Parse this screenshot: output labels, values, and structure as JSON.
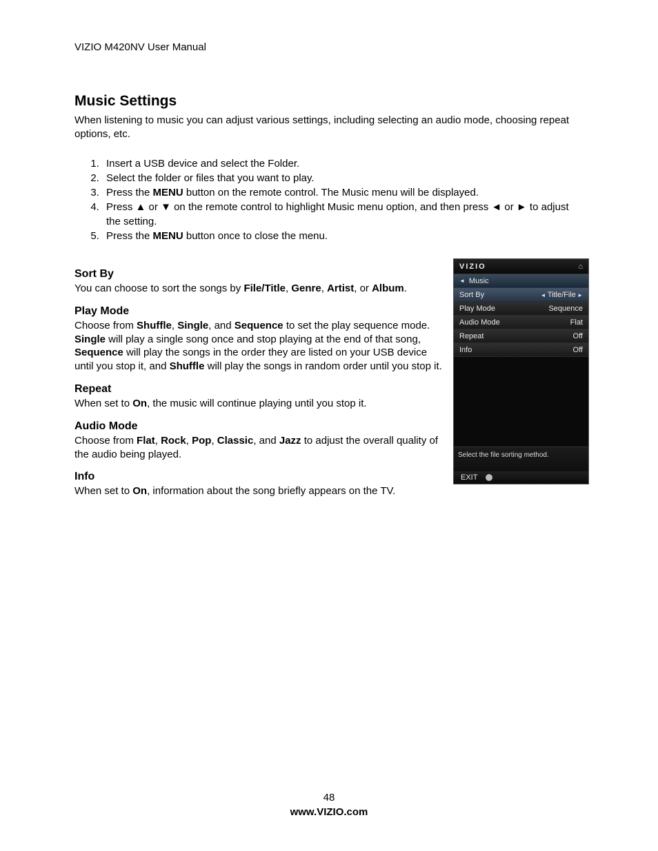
{
  "header": {
    "doc_title": "VIZIO M420NV User Manual"
  },
  "section": {
    "title": "Music Settings",
    "intro": "When listening to music you can adjust various settings, including selecting an audio mode, choosing repeat options, etc."
  },
  "steps": {
    "s1a": "Insert a USB device and select the ",
    "s1b": " Folder.",
    "s2": "Select the folder or files that you want to play.",
    "s3a": "Press the ",
    "s3b": "MENU",
    "s3c": " button on the remote control. The Music menu will be displayed.",
    "s4a": "Press ",
    "s4up": "▲",
    "s4b": " or ",
    "s4dn": "▼",
    "s4c": " on the remote control to highlight Music menu option, and then press ",
    "s4lf": "◄",
    "s4d": " or ",
    "s4rt": "►",
    "s4e": " to adjust the setting.",
    "s5a": "Press the ",
    "s5b": "MENU",
    "s5c": " button once to close the menu."
  },
  "subs": {
    "sortby": {
      "title": "Sort By",
      "a": "You can choose to sort the songs by ",
      "b1": "File/Title",
      "c1": ", ",
      "b2": "Genre",
      "c2": ", ",
      "b3": "Artist",
      "c3": ", or ",
      "b4": "Album",
      "c4": "."
    },
    "playmode": {
      "title": "Play Mode",
      "a": "Choose from ",
      "b1": "Shuffle",
      "c1": ", ",
      "b2": "Single",
      "c2": ", and ",
      "b3": "Sequence",
      "c3": " to set the play sequence mode. ",
      "b4": "Single",
      "c4": " will play a single song once and stop playing at the end of that song, ",
      "b5": "Sequence",
      "c5": " will play the songs in the order they are listed on your USB device until you stop it, and ",
      "b6": "Shuffle",
      "c6": " will play the songs in random order until you stop it."
    },
    "repeat": {
      "title": "Repeat",
      "a": "When set to ",
      "b1": "On",
      "c1": ", the music will continue playing until you stop it."
    },
    "audiomode": {
      "title": "Audio Mode",
      "a": "Choose from ",
      "b1": "Flat",
      "c1": ", ",
      "b2": "Rock",
      "c2": ", ",
      "b3": "Pop",
      "c3": ", ",
      "b4": "Classic",
      "c4": ", and ",
      "b5": "Jazz",
      "c5": " to adjust the overall quality of the audio being played."
    },
    "info": {
      "title": "Info",
      "a": "When set to ",
      "b1": "On",
      "c1": ", information about the song briefly appears on the TV."
    }
  },
  "osd": {
    "brand": "VIZIO",
    "crumb_arrow": "◄",
    "crumb": "Music",
    "rows": [
      {
        "label": "Sort By",
        "value": "Title/File",
        "selected": true
      },
      {
        "label": "Play Mode",
        "value": "Sequence",
        "selected": false
      },
      {
        "label": "Audio Mode",
        "value": "Flat",
        "selected": false
      },
      {
        "label": "Repeat",
        "value": "Off",
        "selected": false
      },
      {
        "label": "Info",
        "value": "Off",
        "selected": false
      }
    ],
    "hint": "Select the file sorting method.",
    "exit": "EXIT"
  },
  "footer": {
    "page_number": "48",
    "url": "www.VIZIO.com"
  }
}
